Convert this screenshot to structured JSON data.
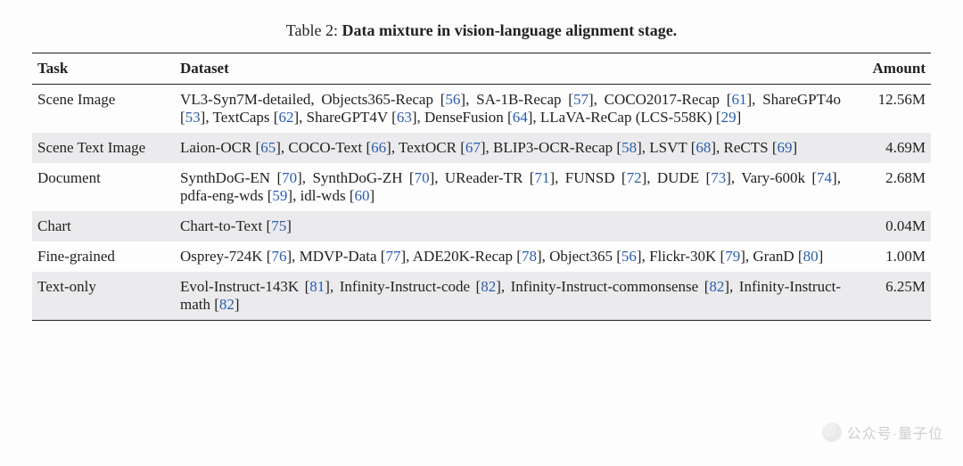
{
  "caption": {
    "label": "Table 2:",
    "title": "Data mixture in vision-language alignment stage."
  },
  "headers": {
    "task": "Task",
    "dataset": "Dataset",
    "amount": "Amount"
  },
  "rows": [
    {
      "task": "Scene Image",
      "amount": "12.56M",
      "datasets": [
        {
          "name": "VL3-Syn7M-detailed",
          "cite": ""
        },
        {
          "name": "Objects365-Recap",
          "cite": "56"
        },
        {
          "name": "SA-1B-Recap",
          "cite": "57"
        },
        {
          "name": "COCO2017-Recap",
          "cite": "61"
        },
        {
          "name": "ShareGPT4o",
          "cite": "53"
        },
        {
          "name": "TextCaps",
          "cite": "62"
        },
        {
          "name": "ShareGPT4V",
          "cite": "63"
        },
        {
          "name": "DenseFusion",
          "cite": "64"
        },
        {
          "name": "LLaVA-ReCap (LCS-558K)",
          "cite": "29"
        }
      ]
    },
    {
      "task": "Scene Text Image",
      "amount": "4.69M",
      "datasets": [
        {
          "name": "Laion-OCR",
          "cite": "65"
        },
        {
          "name": "COCO-Text",
          "cite": "66"
        },
        {
          "name": "TextOCR",
          "cite": "67"
        },
        {
          "name": "BLIP3-OCR-Recap",
          "cite": "58"
        },
        {
          "name": "LSVT",
          "cite": "68"
        },
        {
          "name": "ReCTS",
          "cite": "69"
        }
      ]
    },
    {
      "task": "Document",
      "amount": "2.68M",
      "datasets": [
        {
          "name": "SynthDoG-EN",
          "cite": "70"
        },
        {
          "name": "SynthDoG-ZH",
          "cite": "70"
        },
        {
          "name": "UReader-TR",
          "cite": "71"
        },
        {
          "name": "FUNSD",
          "cite": "72"
        },
        {
          "name": "DUDE",
          "cite": "73"
        },
        {
          "name": "Vary-600k",
          "cite": "74"
        },
        {
          "name": "pdfa-eng-wds",
          "cite": "59"
        },
        {
          "name": "idl-wds",
          "cite": "60"
        }
      ]
    },
    {
      "task": "Chart",
      "amount": "0.04M",
      "datasets": [
        {
          "name": "Chart-to-Text",
          "cite": "75"
        }
      ]
    },
    {
      "task": "Fine-grained",
      "amount": "1.00M",
      "datasets": [
        {
          "name": "Osprey-724K",
          "cite": "76"
        },
        {
          "name": "MDVP-Data",
          "cite": "77"
        },
        {
          "name": "ADE20K-Recap",
          "cite": "78"
        },
        {
          "name": "Object365",
          "cite": "56"
        },
        {
          "name": "Flickr-30K",
          "cite": "79"
        },
        {
          "name": "GranD",
          "cite": "80"
        }
      ]
    },
    {
      "task": "Text-only",
      "amount": "6.25M",
      "datasets": [
        {
          "name": "Evol-Instruct-143K",
          "cite": "81"
        },
        {
          "name": "Infinity-Instruct-code",
          "cite": "82"
        },
        {
          "name": "Infinity-Instruct-commonsense",
          "cite": "82"
        },
        {
          "name": "Infinity-Instruct-math",
          "cite": "82"
        }
      ]
    }
  ],
  "watermark": "公众号·量子位"
}
